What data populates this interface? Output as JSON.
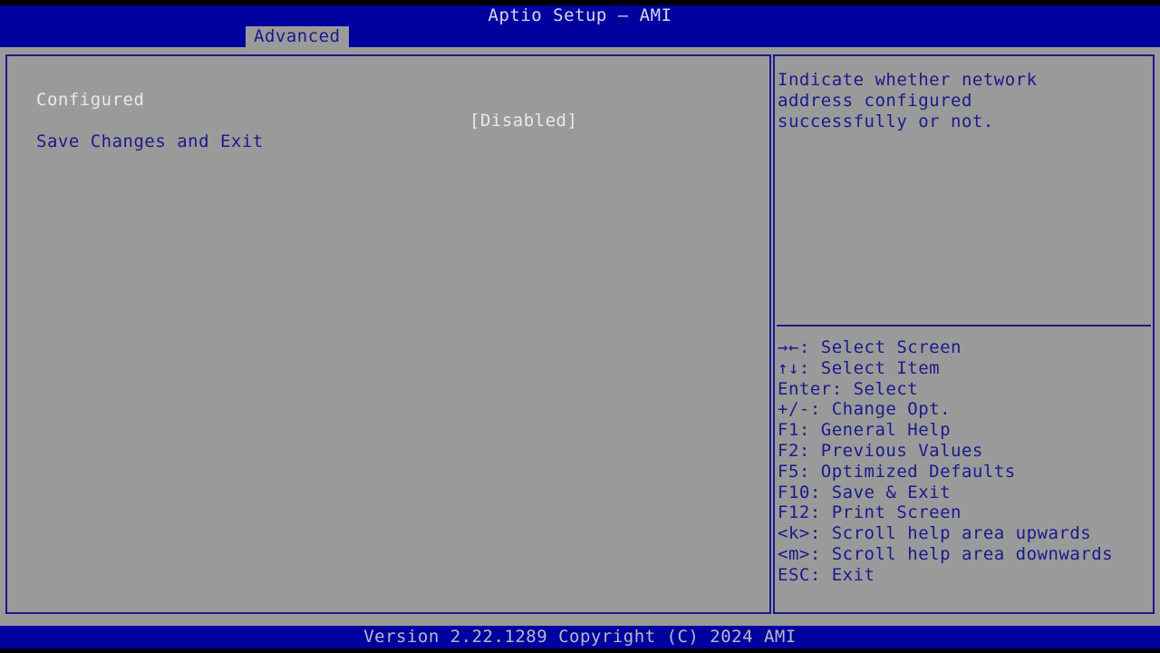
{
  "header": {
    "title": "Aptio Setup – AMI",
    "tabs": [
      {
        "id": "advanced",
        "label": "Advanced",
        "selected": true
      }
    ]
  },
  "settings": {
    "rows": [
      {
        "label": "Configured",
        "value": "[Disabled]",
        "highlighted": true
      },
      {
        "label": "Save Changes and Exit",
        "value": "",
        "highlighted": false
      }
    ]
  },
  "help": {
    "lines": [
      "Indicate whether network",
      "address configured",
      "successfully or not."
    ]
  },
  "key_legend": {
    "items": [
      {
        "key": "→←:",
        "action": "Select Screen",
        "icon": "arrow-left-right-icon"
      },
      {
        "key": "↑↓:",
        "action": "Select Item",
        "icon": "arrow-up-down-icon"
      },
      {
        "key": "Enter:",
        "action": "Select",
        "icon": ""
      },
      {
        "key": "+/-:",
        "action": "Change Opt.",
        "icon": ""
      },
      {
        "key": "F1:",
        "action": "General Help",
        "icon": ""
      },
      {
        "key": "F2:",
        "action": "Previous Values",
        "icon": ""
      },
      {
        "key": "F5:",
        "action": "Optimized Defaults",
        "icon": ""
      },
      {
        "key": "F10:",
        "action": "Save & Exit",
        "icon": ""
      },
      {
        "key": "F12:",
        "action": "Print Screen",
        "icon": ""
      },
      {
        "key": "<k>:",
        "action": "Scroll help area upwards",
        "icon": ""
      },
      {
        "key": "<m>:",
        "action": "Scroll help area downwards",
        "icon": ""
      },
      {
        "key": "ESC:",
        "action": "Exit",
        "icon": ""
      }
    ],
    "lines": [
      "→←: Select Screen",
      "↑↓: Select Item",
      "Enter: Select",
      "+/-: Change Opt.",
      "F1: General Help",
      "F2: Previous Values",
      "F5: Optimized Defaults",
      "F10: Save & Exit",
      "F12: Print Screen",
      "<k>: Scroll help area upwards",
      "<m>: Scroll help area downwards",
      "ESC: Exit"
    ]
  },
  "footer": {
    "version_text": "Version 2.22.1289 Copyright (C) 2024 AMI"
  },
  "colors": {
    "header_blue": "#00009e",
    "panel_gray": "#9a9a9a",
    "text_blue": "#1a1a8c",
    "text_white": "#e8e8e8",
    "footer_text": "#b8b8c8"
  }
}
